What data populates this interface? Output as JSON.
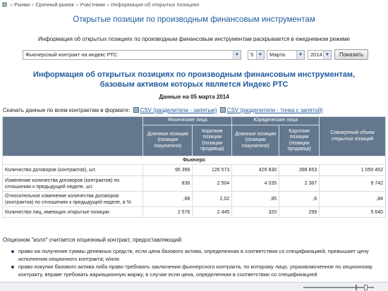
{
  "breadcrumb": {
    "items": [
      "Рынки",
      "Срочный рынок",
      "Участники",
      "Информация об открытых позициях"
    ]
  },
  "page_title": "Открытые позиции по производным финансовым инструментам",
  "intro_text": "Информация об открытых позициях по производным финансовым инструментам раскрывается в ежедневном режиме",
  "form": {
    "contract": "Фьючерсный контракт на индекс РТС",
    "day": "5",
    "month": "Марта",
    "year": "2014",
    "show_button": "Показать"
  },
  "heading": {
    "line1": "Информация об открытых позициях по производным финансовым инструментам,",
    "line2": "базовым активом которых является Индекс РТС"
  },
  "date_line": "Данные на 05 марта 2014",
  "download": {
    "label": "Скачать данные по всем контрактам в формате:",
    "csv_comma": "CSV (разделители - запятые)",
    "csv_semicolon": "CSV (разделители - точка с запятой)"
  },
  "table": {
    "group_individuals": "Физические лица",
    "group_legal": "Юридические лица",
    "total_header": "Совокупный объем открытых позиций",
    "long_header": "Длинные позиции (позиции покупателя)",
    "short_header": "Короткие позиции (позиции продавца)",
    "section_label": "Фьючерс",
    "rows": [
      {
        "label": "Количество договоров (контрактов), шт.",
        "values": [
          "95 396",
          "126 573",
          "429 830",
          "398 653",
          "1 050 452"
        ]
      },
      {
        "label": "Изменение количества договоров (контрактов) по отношению к предыдущей неделе, шт.",
        "values": [
          "836",
          "2 504",
          "4 035",
          "2 367",
          "9 742"
        ]
      },
      {
        "label": "Относительное изменение количества договоров (контрактов) по отношению к предыдущей неделе, в %",
        "values": [
          ",88",
          "2,02",
          ",95",
          ",6",
          ",84"
        ]
      },
      {
        "label": "Количество лиц, имеющих открытые позиции",
        "values": [
          "2 576",
          "2 445",
          "320",
          "299",
          "5 640"
        ]
      }
    ]
  },
  "option_note": "Опционом \"колл\" считается опционный контракт, предоставляющий:",
  "rights": [
    "право на получение суммы денежных средств, если цена базового актива, определенная в соответствии со спецификацией, превышает цену исполнения опционного контракта; и/или",
    "право покупки базового актива либо право требовать заключения фьючерсного контракта, по которому лицо, упраовомоченное по опционному контракту, вправе требовать вариационную маржу, в случае если цена, определенная в соответствии со спецификацией"
  ],
  "colors": {
    "title_blue": "#1e5a9c",
    "header_bg": "#63788e"
  }
}
